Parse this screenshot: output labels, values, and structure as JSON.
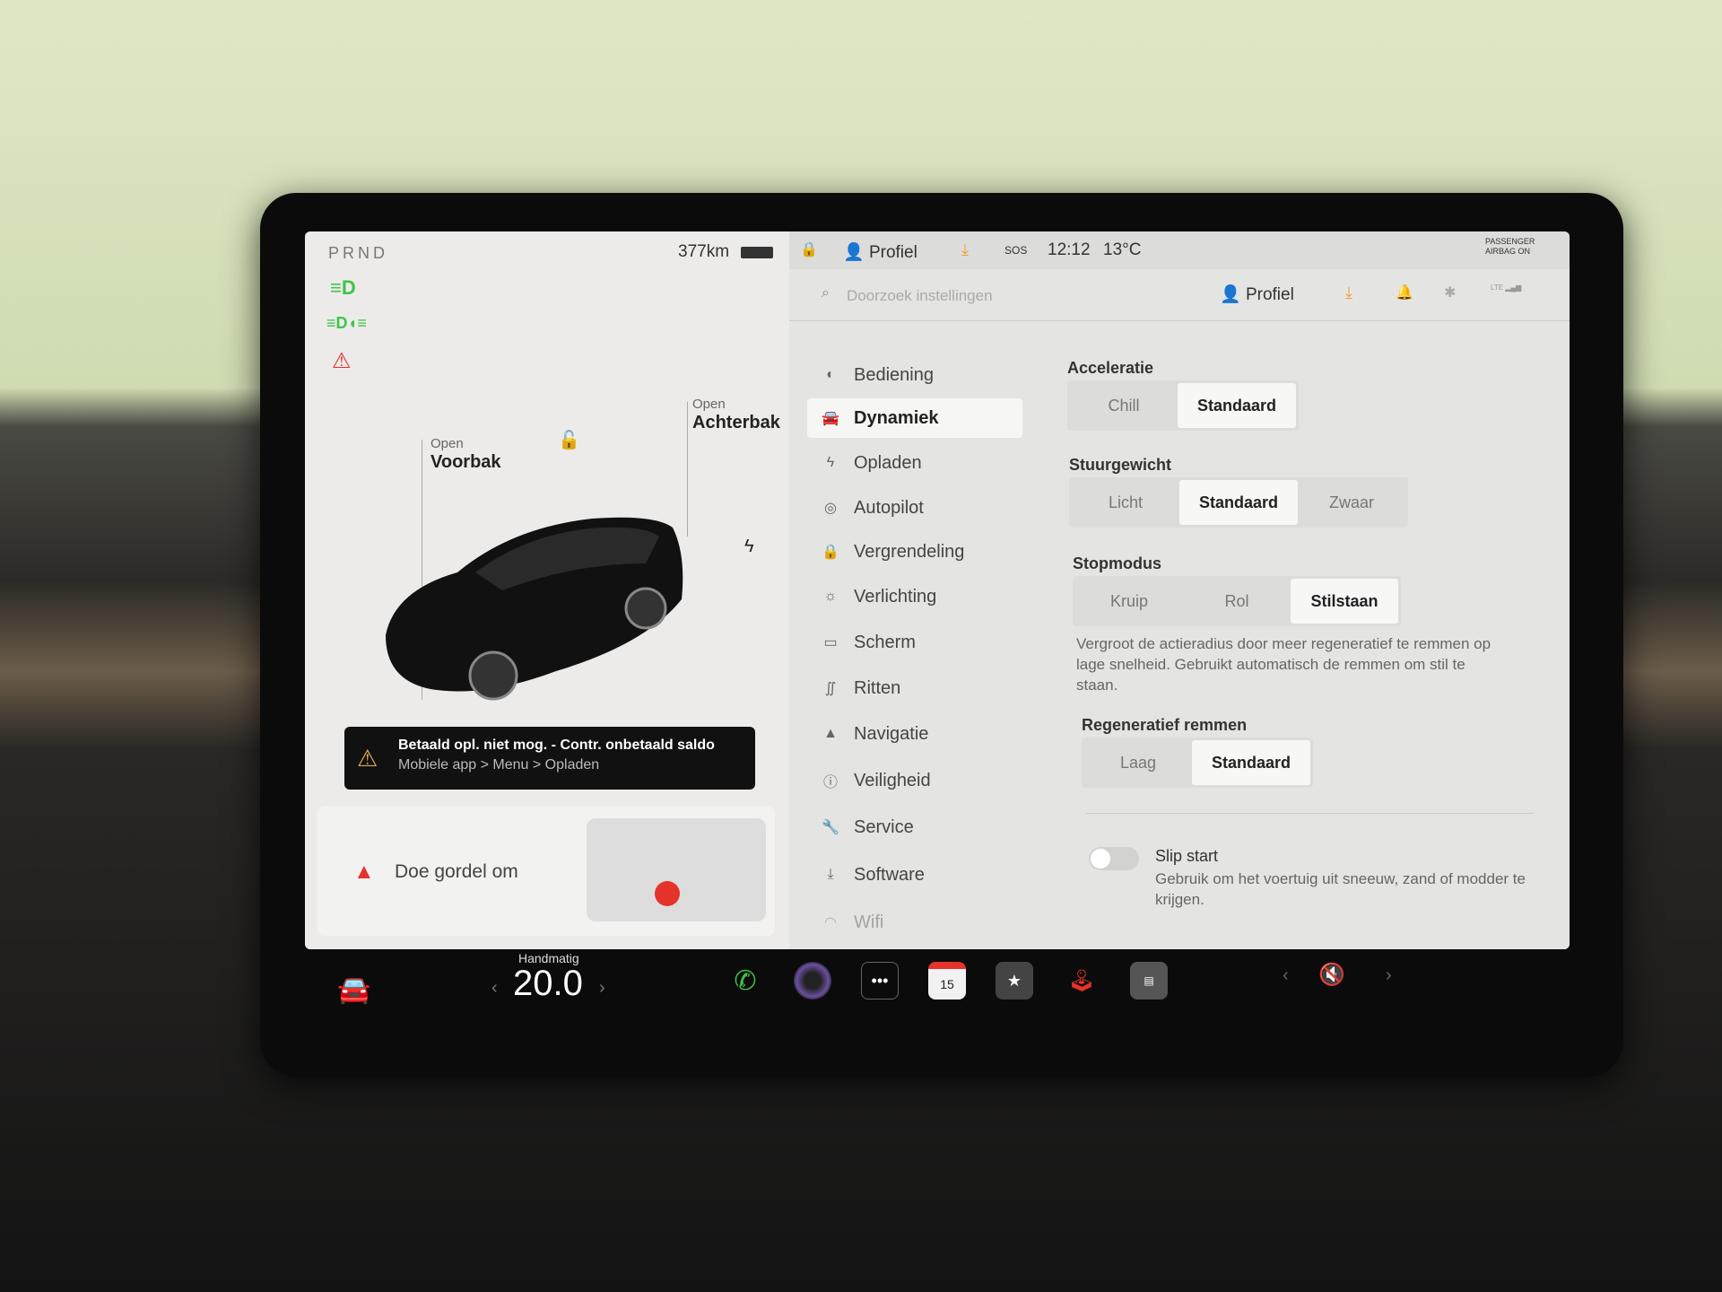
{
  "status_bar": {
    "gear": "PRND",
    "range": "377km",
    "profile": "Profiel",
    "sos": "SOS",
    "time": "12:12",
    "temperature": "13°C",
    "airbag_line1": "PASSENGER",
    "airbag_line2": "AIRBAG ON"
  },
  "car_panel": {
    "frunk": {
      "state": "Open",
      "label": "Voorbak"
    },
    "trunk": {
      "state": "Open",
      "label": "Achterbak"
    },
    "alert": {
      "title": "Betaald opl. niet mog. - Contr. onbetaald saldo",
      "subtitle": "Mobiele app > Menu > Opladen"
    },
    "seatbelt": {
      "text": "Doe gordel om"
    }
  },
  "settings_header": {
    "search_placeholder": "Doorzoek instellingen",
    "profile": "Profiel",
    "lte": "LTE"
  },
  "sidebar": {
    "items": [
      {
        "label": "Bediening",
        "icon": "toggle-icon"
      },
      {
        "label": "Dynamiek",
        "icon": "car-icon",
        "active": true
      },
      {
        "label": "Opladen",
        "icon": "bolt-icon"
      },
      {
        "label": "Autopilot",
        "icon": "steering-wheel-icon"
      },
      {
        "label": "Vergrendeling",
        "icon": "lock-icon"
      },
      {
        "label": "Verlichting",
        "icon": "sun-icon"
      },
      {
        "label": "Scherm",
        "icon": "display-icon"
      },
      {
        "label": "Ritten",
        "icon": "trips-icon"
      },
      {
        "label": "Navigatie",
        "icon": "navigation-icon"
      },
      {
        "label": "Veiligheid",
        "icon": "safety-icon"
      },
      {
        "label": "Service",
        "icon": "wrench-icon"
      },
      {
        "label": "Software",
        "icon": "download-icon"
      },
      {
        "label": "Wifi",
        "icon": "wifi-icon"
      }
    ]
  },
  "dynamics": {
    "acceleration": {
      "title": "Acceleratie",
      "options": [
        "Chill",
        "Standaard"
      ],
      "selected": "Standaard"
    },
    "steering": {
      "title": "Stuurgewicht",
      "options": [
        "Licht",
        "Standaard",
        "Zwaar"
      ],
      "selected": "Standaard"
    },
    "stop_mode": {
      "title": "Stopmodus",
      "options": [
        "Kruip",
        "Rol",
        "Stilstaan"
      ],
      "selected": "Stilstaan",
      "description": "Vergroot de actieradius door meer regeneratief te remmen op lage snelheid. Gebruikt automatisch de remmen om stil te staan."
    },
    "regen": {
      "title": "Regeneratief remmen",
      "options": [
        "Laag",
        "Standaard"
      ],
      "selected": "Standaard"
    },
    "slip_start": {
      "label": "Slip start",
      "description": "Gebruik om het voertuig uit sneeuw, zand of modder te krijgen.",
      "enabled": false
    }
  },
  "taskbar": {
    "climate_mode": "Handmatig",
    "temperature": "20.0",
    "calendar_day": "15"
  },
  "colors": {
    "accent_green": "#3ec44a",
    "warning_red": "#e5332a",
    "orange": "#f0a030"
  }
}
